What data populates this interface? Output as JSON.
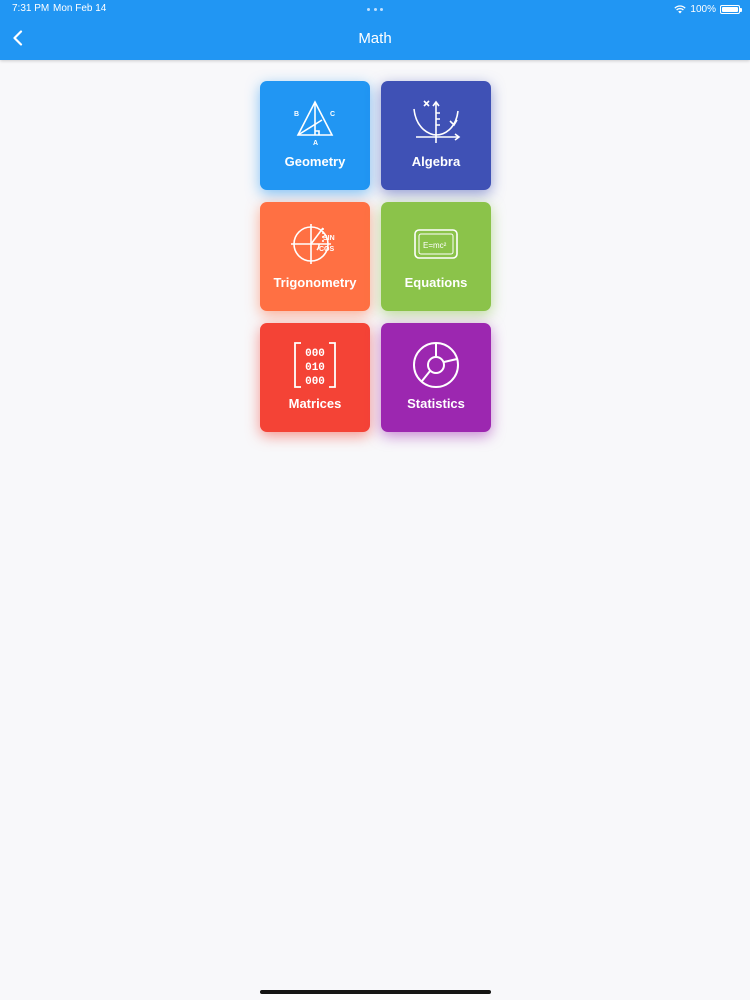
{
  "status_bar": {
    "time": "7:31 PM",
    "date": "Mon Feb 14",
    "battery": "100%"
  },
  "nav": {
    "title": "Math",
    "back_icon": "chevron-left-icon"
  },
  "tiles": [
    {
      "label": "Geometry",
      "icon": "geometry-triangle-icon",
      "color": "#2196f3"
    },
    {
      "label": "Algebra",
      "icon": "algebra-graph-icon",
      "color": "#3f51b5"
    },
    {
      "label": "Trigonometry",
      "icon": "trigonometry-circle-icon",
      "color": "#ff7043"
    },
    {
      "label": "Equations",
      "icon": "equation-board-icon",
      "color": "#8bc34a"
    },
    {
      "label": "Matrices",
      "icon": "matrix-brackets-icon",
      "color": "#f44336"
    },
    {
      "label": "Statistics",
      "icon": "pie-chart-icon",
      "color": "#9c27b0"
    }
  ],
  "icon_text": {
    "geometry_b": "B",
    "geometry_c": "C",
    "geometry_a": "A",
    "trig_sin": "SIN",
    "trig_cos": "COS",
    "equation": "E=mc²",
    "matrix_row1": "000",
    "matrix_row2": "010",
    "matrix_row3": "000"
  }
}
